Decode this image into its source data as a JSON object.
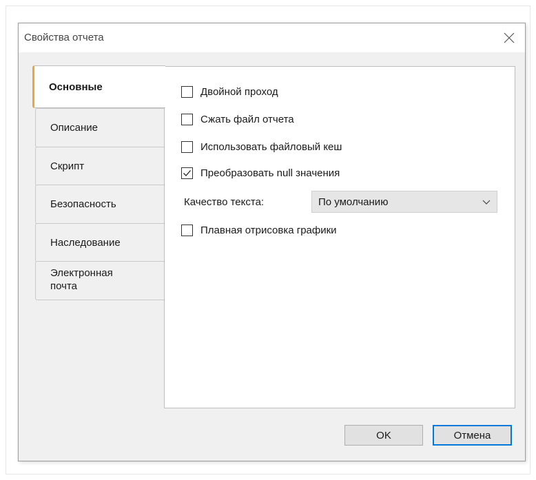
{
  "dialog": {
    "title": "Свойства отчета"
  },
  "tabs": [
    {
      "label": "Основные",
      "active": true
    },
    {
      "label": "Описание",
      "active": false
    },
    {
      "label": "Скрипт",
      "active": false
    },
    {
      "label": "Безопасность",
      "active": false
    },
    {
      "label": "Наследование",
      "active": false
    },
    {
      "label": "Электронная почта",
      "active": false
    }
  ],
  "general": {
    "double_pass": {
      "label": "Двойной проход",
      "checked": false
    },
    "compress": {
      "label": "Сжать файл отчета",
      "checked": false
    },
    "file_cache": {
      "label": "Использовать файловый кеш",
      "checked": false
    },
    "convert_null": {
      "label": "Преобразовать null значения",
      "checked": true
    },
    "text_quality_label": "Качество текста:",
    "text_quality_value": "По умолчанию",
    "smooth_graphics": {
      "label": "Плавная отрисовка графики",
      "checked": false
    }
  },
  "buttons": {
    "ok": "OK",
    "cancel": "Отмена"
  },
  "colors": {
    "active_tab_accent": "#f2a33a",
    "focus_border": "#0078d7"
  },
  "icons": {
    "close": "close-icon",
    "checkmark": "checkmark-icon",
    "dropdown": "chevron-down-icon"
  }
}
